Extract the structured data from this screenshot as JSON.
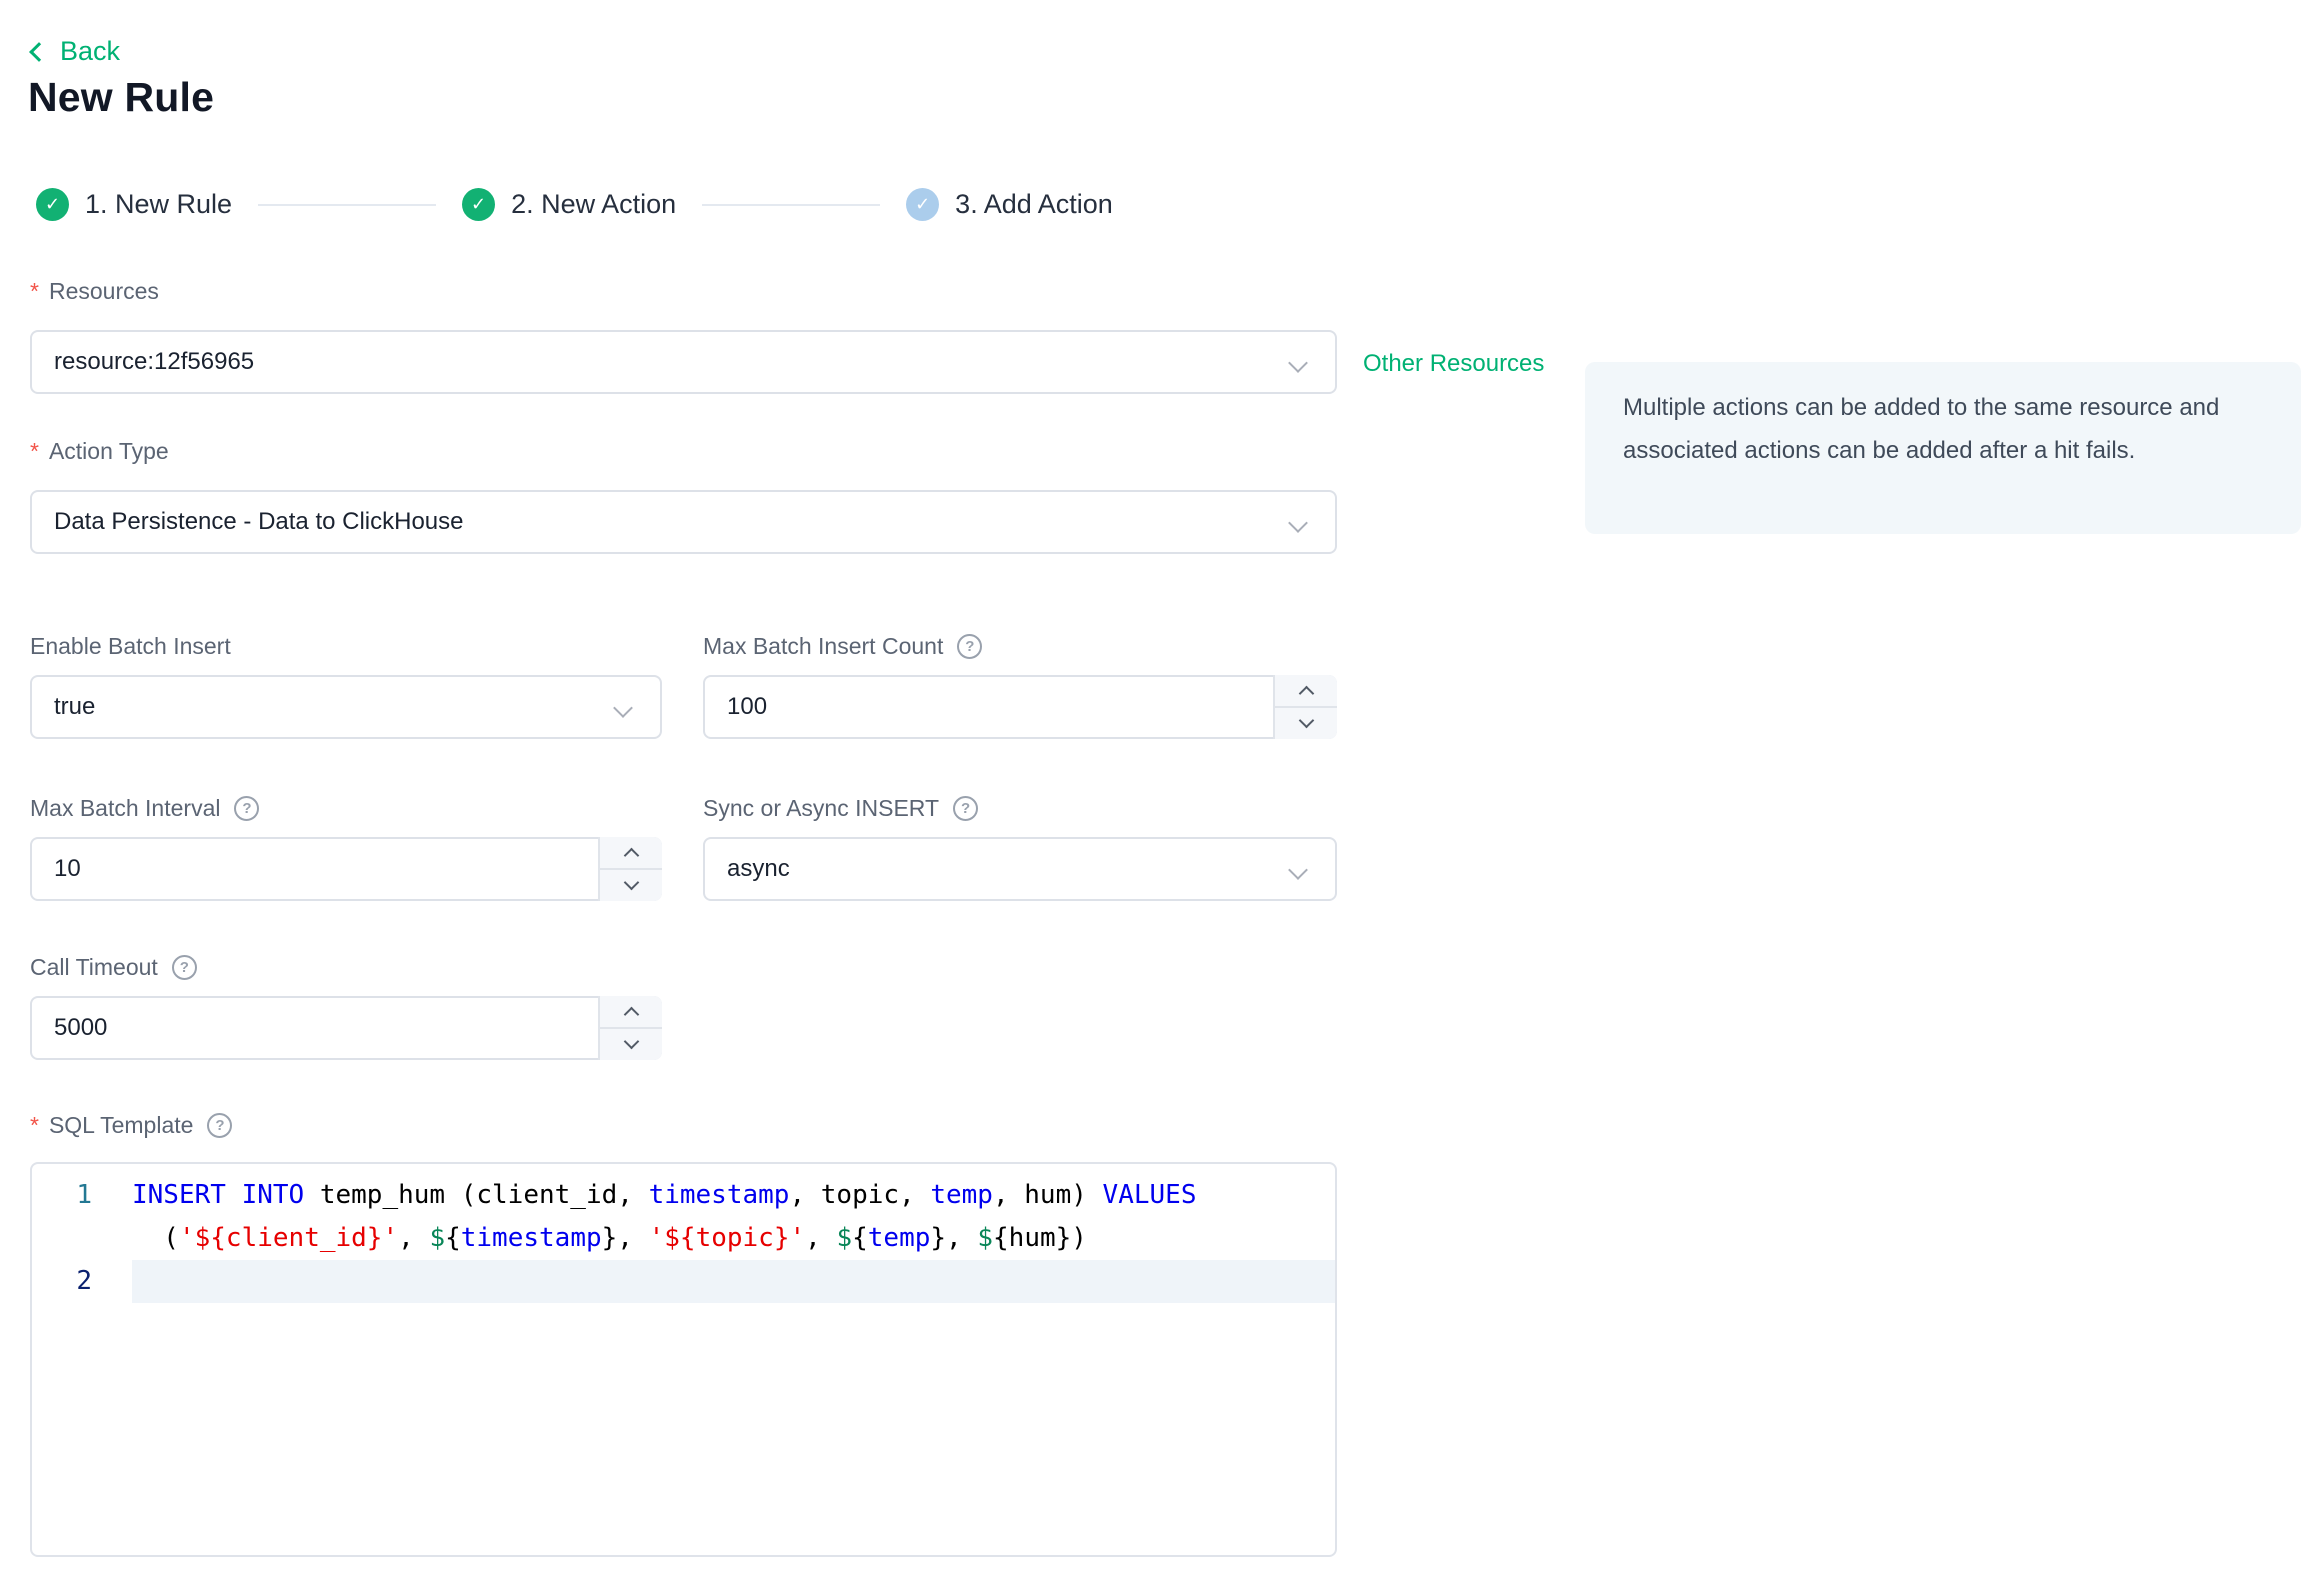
{
  "ui": {
    "required_mark": "*",
    "help_glyph": "?",
    "check_glyph": "✓"
  },
  "colors": {
    "brand_green": "#00b173",
    "step_done_green": "#12b173",
    "step_pending_blue": "#abcdec",
    "required_red": "#f25449",
    "info_card_bg": "#f2f7fa",
    "active_line_bg": "#eff4f9",
    "keyword_blue": "#0000ee",
    "string_red": "#e60000",
    "variable_green": "#098658"
  },
  "header": {
    "back_label": "Back",
    "title": "New Rule"
  },
  "stepper": {
    "steps": [
      {
        "label": "1. New Rule",
        "state": "done"
      },
      {
        "label": "2. New Action",
        "state": "done"
      },
      {
        "label": "3. Add Action",
        "state": "pending"
      }
    ]
  },
  "form": {
    "resources": {
      "label": "Resources",
      "value": "resource:12f56965",
      "other_link": "Other Resources"
    },
    "action_type": {
      "label": "Action Type",
      "value": "Data Persistence - Data to ClickHouse"
    },
    "enable_batch": {
      "label": "Enable Batch Insert",
      "value": "true"
    },
    "max_batch_count": {
      "label": "Max Batch Insert Count",
      "value": "100"
    },
    "max_batch_interval": {
      "label": "Max Batch Interval",
      "value": "10"
    },
    "sync_async": {
      "label": "Sync or Async INSERT",
      "value": "async"
    },
    "call_timeout": {
      "label": "Call Timeout",
      "value": "5000"
    },
    "sql_template": {
      "label": "SQL Template"
    }
  },
  "info_card": {
    "text": "Multiple actions can be added to the same resource and associated actions can be added after a hit fails."
  },
  "sql_editor": {
    "sql_text": "INSERT INTO temp_hum (client_id, timestamp, topic, temp, hum) VALUES ('${client_id}', ${timestamp}, '${topic}', ${temp}, ${hum})",
    "lines": [
      {
        "number": "1",
        "active": false,
        "rows": [
          [
            {
              "t": "INSERT INTO",
              "c": "kw"
            },
            {
              "t": " temp_hum (client_id, ",
              "c": "pl"
            },
            {
              "t": "timestamp",
              "c": "kw"
            },
            {
              "t": ", topic, ",
              "c": "pl"
            },
            {
              "t": "temp",
              "c": "kw"
            },
            {
              "t": ", hum) ",
              "c": "pl"
            },
            {
              "t": "VALUES",
              "c": "kw"
            }
          ],
          [
            {
              "t": "  (",
              "c": "pl"
            },
            {
              "t": "'${client_id}'",
              "c": "str"
            },
            {
              "t": ", ",
              "c": "pl"
            },
            {
              "t": "$",
              "c": "var"
            },
            {
              "t": "{",
              "c": "pl"
            },
            {
              "t": "timestamp",
              "c": "kw"
            },
            {
              "t": "}, ",
              "c": "pl"
            },
            {
              "t": "'${topic}'",
              "c": "str"
            },
            {
              "t": ", ",
              "c": "pl"
            },
            {
              "t": "$",
              "c": "var"
            },
            {
              "t": "{",
              "c": "pl"
            },
            {
              "t": "temp",
              "c": "kw"
            },
            {
              "t": "}, ",
              "c": "pl"
            },
            {
              "t": "$",
              "c": "var"
            },
            {
              "t": "{hum})",
              "c": "pl"
            }
          ]
        ]
      },
      {
        "number": "2",
        "active": true,
        "rows": [
          []
        ]
      }
    ]
  }
}
